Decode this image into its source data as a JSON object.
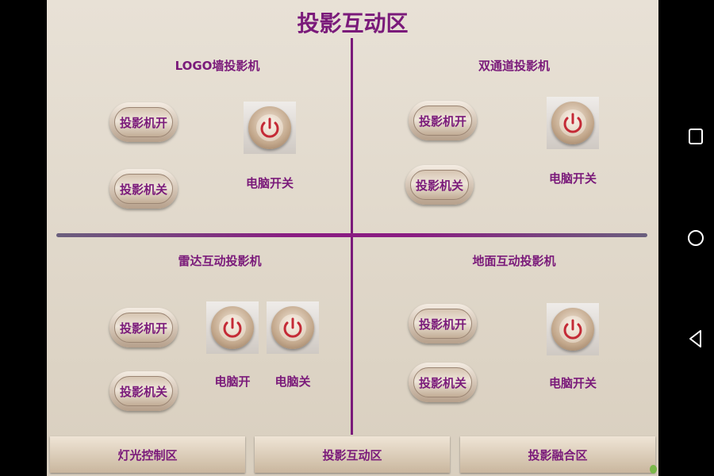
{
  "screen": {
    "title": "投影互动区",
    "quadrants": [
      {
        "name": "LOGO墙投影机",
        "on_label": "投影机开",
        "off_label": "投影机关",
        "power_labels": [
          "电脑开关"
        ]
      },
      {
        "name": "双通道投影机",
        "on_label": "投影机开",
        "off_label": "投影机关",
        "power_labels": [
          "电脑开关"
        ]
      },
      {
        "name": "雷达互动投影机",
        "on_label": "投影机开",
        "off_label": "投影机关",
        "power_labels": [
          "电脑开",
          "电脑关"
        ]
      },
      {
        "name": "地面互动投影机",
        "on_label": "投影机开",
        "off_label": "投影机关",
        "power_labels": [
          "电脑开关"
        ]
      }
    ],
    "tabs": [
      "灯光控制区",
      "投影互动区",
      "投影融合区"
    ]
  },
  "android_nav": {
    "icons": [
      "recents-square-icon",
      "home-circle-icon",
      "back-triangle-icon"
    ]
  },
  "colors": {
    "accent": "#7a1a7a",
    "power_icon": "#c42a36",
    "background": "#e2dacd"
  }
}
